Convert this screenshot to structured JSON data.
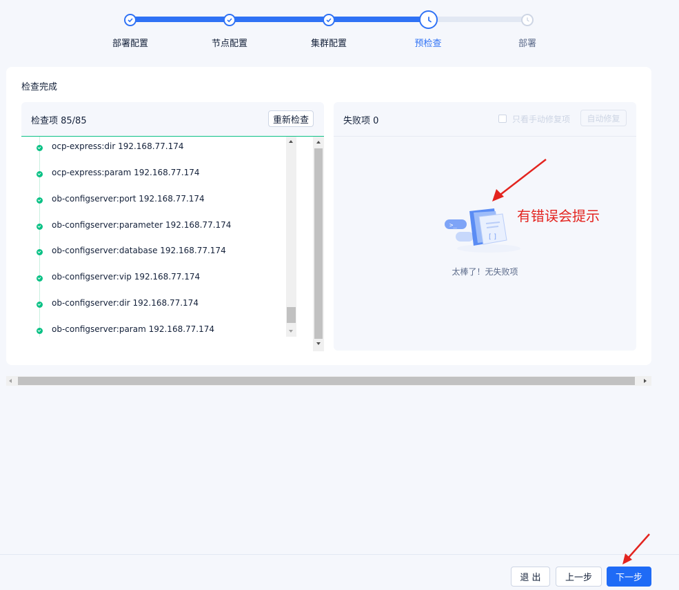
{
  "stepper": {
    "steps": [
      {
        "label": "部署配置",
        "state": "done"
      },
      {
        "label": "节点配置",
        "state": "done"
      },
      {
        "label": "集群配置",
        "state": "done"
      },
      {
        "label": "预检查",
        "state": "active"
      },
      {
        "label": "部署",
        "state": "todo"
      }
    ]
  },
  "card": {
    "title": "检查完成"
  },
  "left_panel": {
    "title": "检查项 85/85",
    "recheck_button": "重新检查",
    "items": [
      "ocp-express:dir 192.168.77.174",
      "ocp-express:param 192.168.77.174",
      "ob-configserver:port 192.168.77.174",
      "ob-configserver:parameter 192.168.77.174",
      "ob-configserver:database 192.168.77.174",
      "ob-configserver:vip 192.168.77.174",
      "ob-configserver:dir 192.168.77.174",
      "ob-configserver:param 192.168.77.174"
    ]
  },
  "right_panel": {
    "title": "失败项 0",
    "manual_fix_checkbox_label": "只看手动修复项",
    "auto_fix_button": "自动修复",
    "empty_text": "太棒了！无失败项"
  },
  "annotation": {
    "text": "有错误会提示"
  },
  "footer": {
    "exit_button": "退 出",
    "prev_button": "上一步",
    "next_button": "下一步"
  },
  "colors": {
    "primary": "#2f72f5",
    "success": "#0ac185",
    "annotation_red": "#e3241f"
  }
}
